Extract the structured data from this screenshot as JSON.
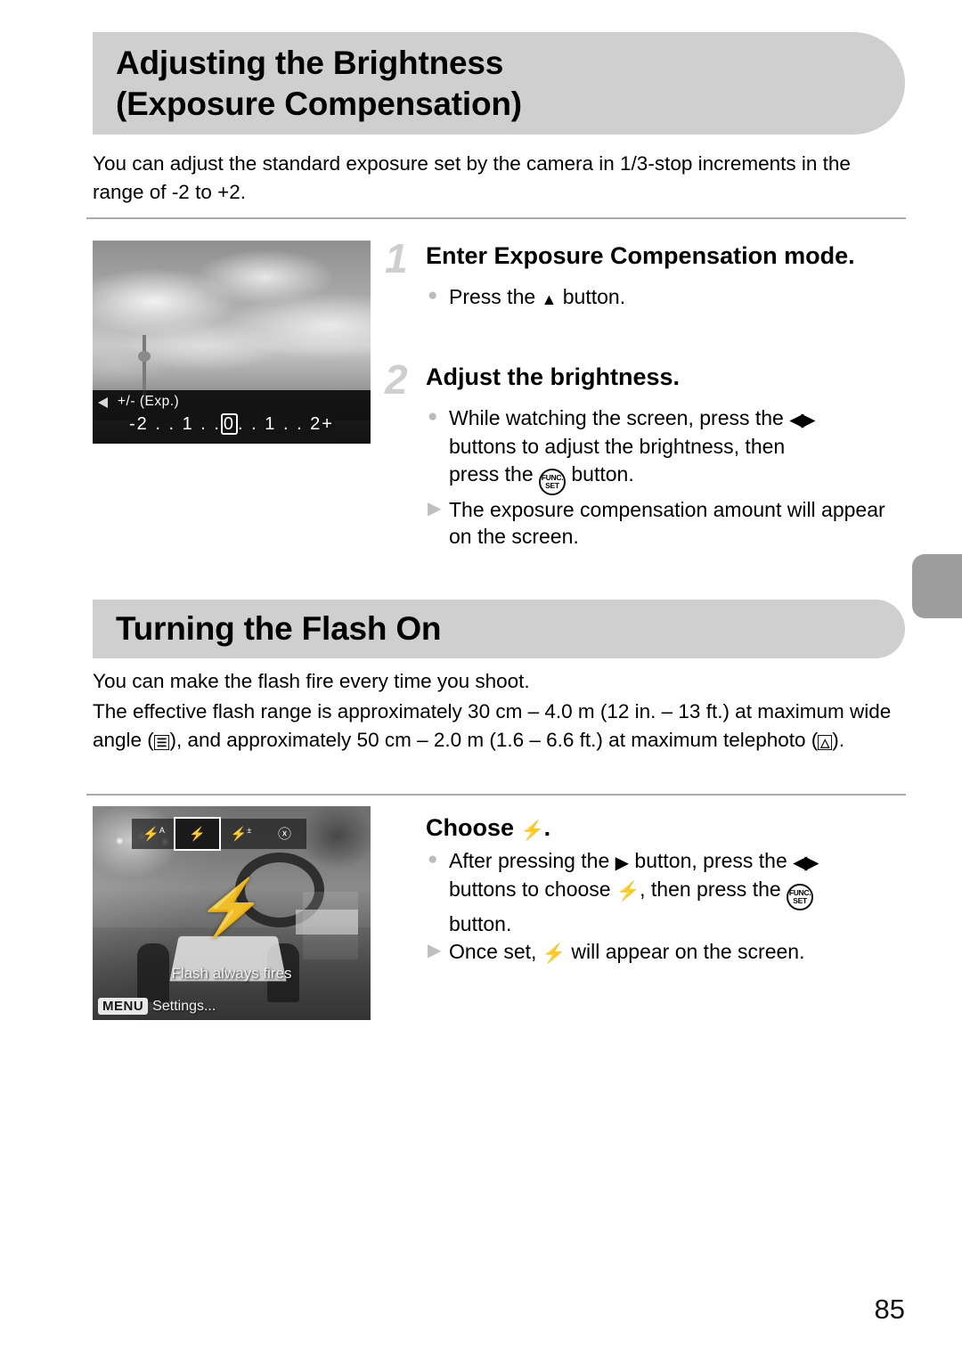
{
  "page": {
    "number": "85",
    "accent_gray": "#cfcfcf",
    "tab_gray": "#9e9e9e"
  },
  "sections": [
    {
      "id": "exposure",
      "banner_title": "Adjusting the Brightness (Exposure Compensation)",
      "banner_line_1": "Adjusting the Brightness",
      "banner_line_2": "(Exposure Compensation)",
      "intro": "You can adjust the standard exposure set by the camera in 1/3-stop increments in the range of -2 to +2.",
      "lcd": {
        "name": "exposure-compensation-screen",
        "overlay_label": "+/- (Exp.)",
        "scale_left": "-2 . . 1 . .",
        "scale_marker": "0",
        "scale_right": ". . 1 . . 2+"
      },
      "steps": [
        {
          "number": "1",
          "title": "Enter Exposure Compensation mode.",
          "bullets": [
            {
              "marker": "dot",
              "pre": "Press the ",
              "icon": "up-button-icon",
              "icon_glyph": "▲",
              "post": " button."
            }
          ]
        },
        {
          "number": "2",
          "title": "Adjust the brightness.",
          "bullets": [
            {
              "marker": "dot",
              "line_1_pre": "While watching the screen, press the ",
              "line_1_icon": "left-right-buttons-icon",
              "line_1_icon_glyph": "◀▶",
              "line_2": "buttons to adjust the brightness, then",
              "line_3_pre": "press the ",
              "line_3_icon": "func-set-button-icon",
              "line_3_icon_top": "FUNC.",
              "line_3_icon_bottom": "SET",
              "line_3_post": " button."
            },
            {
              "marker": "triangle",
              "text": "The exposure compensation amount will appear on the screen."
            }
          ]
        }
      ]
    },
    {
      "id": "flash",
      "banner_title": "Turning the Flash On",
      "intro_1": "You can make the flash fire every time you shoot.",
      "intro_2_a": "The effective flash range is approximately 30 cm – 4.0 m (12 in. – 13 ft.) at maximum wide angle (",
      "intro_2_wide_icon": "wide-angle-zoom-icon",
      "intro_2_wide_glyph": "⬚",
      "intro_2_b": "), and approximately 50 cm – 2.0 m (1.6 – 6.6 ft.) at maximum telephoto (",
      "intro_2_tele_icon": "telephoto-zoom-icon",
      "intro_2_tele_glyph": "⬚",
      "intro_2_c": ").",
      "lcd": {
        "name": "flash-settings-screen",
        "menu_items": [
          {
            "name": "flash-auto-icon",
            "label": "⚡",
            "sup": "A",
            "selected": false
          },
          {
            "name": "flash-on-icon",
            "label": "⚡",
            "sup": "",
            "selected": true
          },
          {
            "name": "flash-slow-sync-icon",
            "label": "⚡",
            "sup": "±",
            "selected": false
          },
          {
            "name": "flash-off-icon",
            "label": "ⓧ",
            "sup": "",
            "selected": false
          }
        ],
        "big_icon": "⚡",
        "caption": "Flash always fires",
        "menu_chip": "MENU",
        "menu_label": "Settings..."
      },
      "steps": [
        {
          "number": "",
          "title_pre": "Choose ",
          "title_icon": "flash-on-icon",
          "title_icon_glyph": "⚡",
          "title_post": ".",
          "bullets": [
            {
              "marker": "dot",
              "line_1_pre": "After pressing the ",
              "line_1_icon": "right-button-icon",
              "line_1_icon_glyph": "▶",
              "line_1_mid": " button, press the ",
              "line_1_icon2": "left-right-buttons-icon",
              "line_1_icon2_glyph": "◀▶",
              "line_2_pre": "buttons to choose ",
              "line_2_icon": "flash-on-icon",
              "line_2_icon_glyph": "⚡",
              "line_2_mid": ", then press the ",
              "line_2_icon2": "func-set-button-icon",
              "line_2_icon2_top": "FUNC.",
              "line_2_icon2_bottom": "SET",
              "line_3": "button."
            },
            {
              "marker": "triangle",
              "pre": "Once set, ",
              "icon": "flash-on-icon",
              "icon_glyph": "⚡",
              "post": " will appear on the screen."
            }
          ]
        }
      ]
    }
  ]
}
